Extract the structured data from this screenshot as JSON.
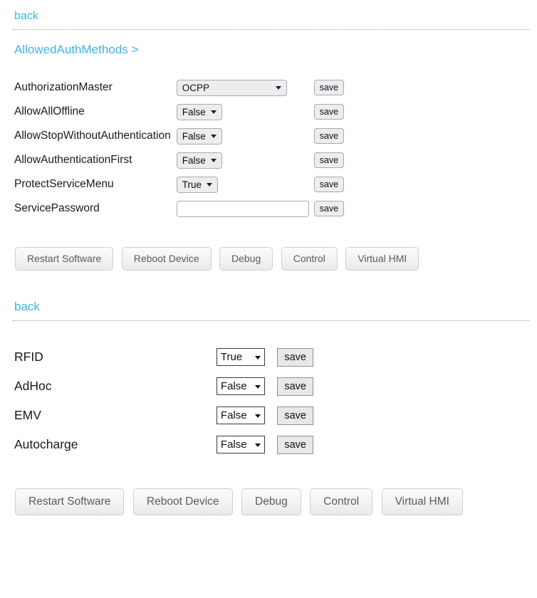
{
  "section_one": {
    "back_label": "back",
    "breadcrumb_label": "AllowedAuthMethods >",
    "save_label": "save",
    "rows": [
      {
        "label": "AuthorizationMaster",
        "control": "select",
        "value": "OCPP",
        "save": "save"
      },
      {
        "label": "AllowAllOffline",
        "control": "select",
        "value": "False",
        "save": "save"
      },
      {
        "label": "AllowStopWithoutAuthentication",
        "control": "select",
        "value": "False",
        "save": "save"
      },
      {
        "label": "AllowAuthenticationFirst",
        "control": "select",
        "value": "False",
        "save": "save"
      },
      {
        "label": "ProtectServiceMenu",
        "control": "select",
        "value": "True",
        "save": "save"
      },
      {
        "label": "ServicePassword",
        "control": "text",
        "value": "",
        "placeholder": "",
        "save": "save"
      }
    ],
    "actions": [
      "Restart Software",
      "Reboot Device",
      "Debug",
      "Control",
      "Virtual HMI"
    ]
  },
  "section_two": {
    "back_label": "back",
    "rows": [
      {
        "label": "RFID",
        "value": "True",
        "save": "save"
      },
      {
        "label": "AdHoc",
        "value": "False",
        "save": "save"
      },
      {
        "label": "EMV",
        "value": "False",
        "save": "save"
      },
      {
        "label": "Autocharge",
        "value": "False",
        "save": "save"
      }
    ],
    "actions": [
      "Restart Software",
      "Reboot Device",
      "Debug",
      "Control",
      "Virtual HMI"
    ]
  },
  "colors": {
    "link": "#3cb4e5",
    "text": "#1a1a1a",
    "button_text": "#5b5b5b",
    "divider": "#9a9a9a"
  }
}
